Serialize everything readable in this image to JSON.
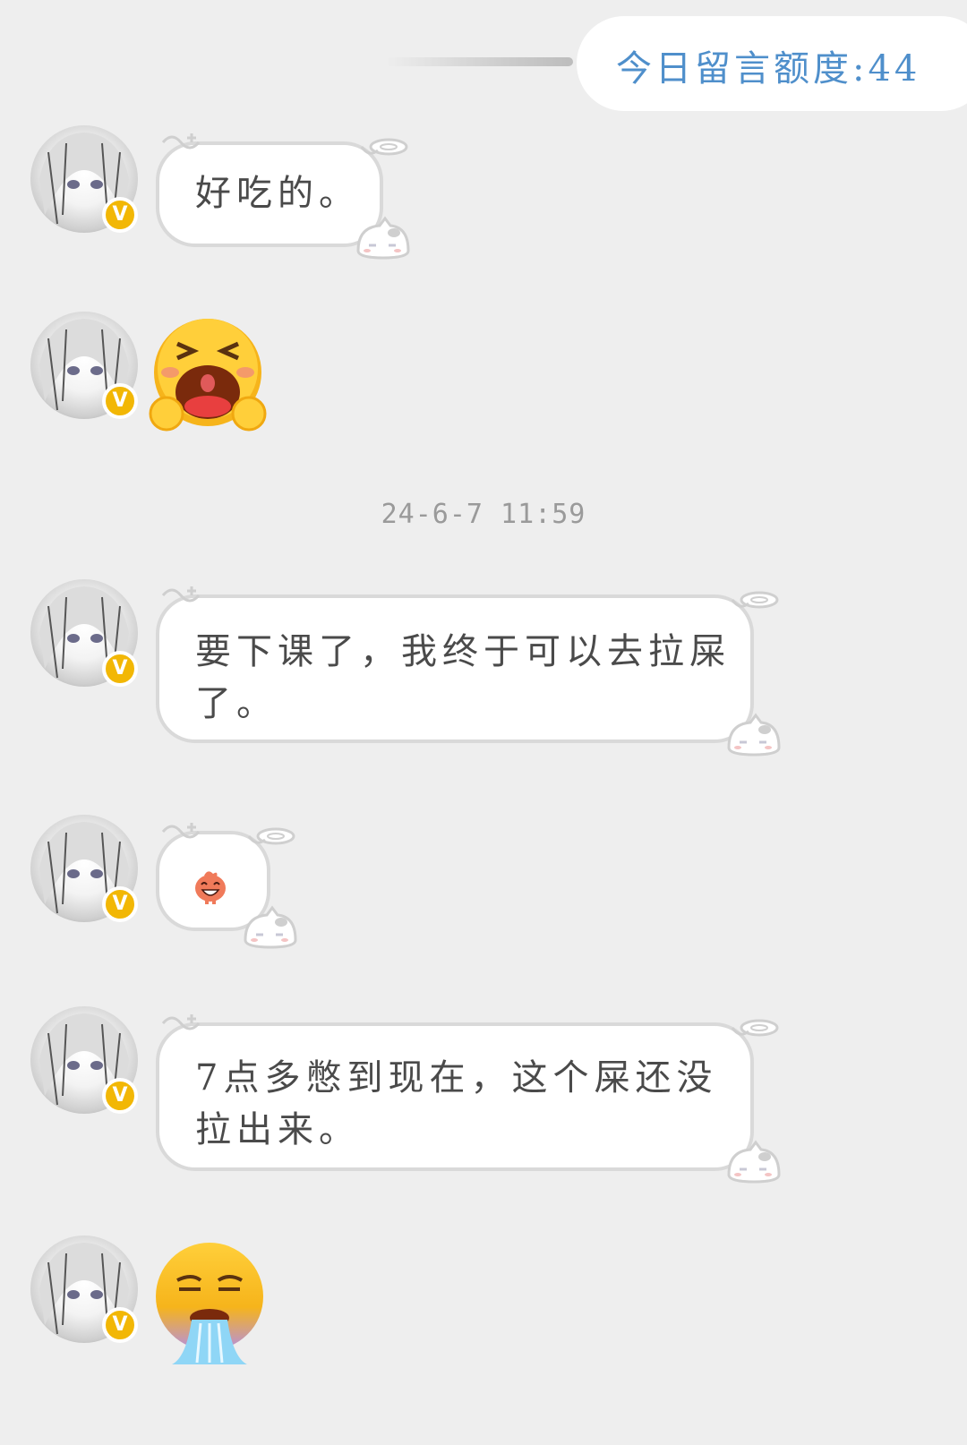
{
  "header": {
    "quota_text": "今日留言额度:44"
  },
  "timestamp": "24-6-7 11:59",
  "messages": [
    {
      "text": "好吃的。"
    },
    {
      "emoji": "crying-loud-emoji"
    },
    {
      "text_line1": "要下课了，我终于可以去拉屎",
      "text_line2": "了。"
    },
    {
      "emoji": "small-laughing-sticker"
    },
    {
      "text_line1": "7点多憋到现在，这个屎还没",
      "text_line2": "拉出来。"
    },
    {
      "emoji": "vomiting-emoji"
    }
  ],
  "colors": {
    "background": "#eeeeee",
    "quota_text": "#4f8fcb",
    "badge": "#f2b705",
    "bubble_border": "#d9d9d9"
  }
}
